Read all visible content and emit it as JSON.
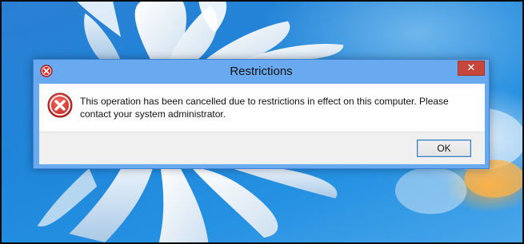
{
  "dialog": {
    "title": "Restrictions",
    "title_icon": "error-icon",
    "close_label": "✕",
    "message": "This operation has been cancelled due to restrictions in effect on this computer. Please contact your system administrator.",
    "message_icon": "error-icon",
    "ok_label": "OK"
  },
  "colors": {
    "titlebar": "#68a9f0",
    "close_button": "#c7463b",
    "error_red": "#d42d2d",
    "ok_border": "#3c7fc1"
  }
}
